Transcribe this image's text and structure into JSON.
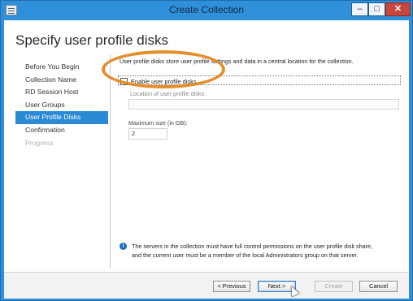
{
  "window": {
    "title": "Create Collection",
    "controls": {
      "minimize": "‒",
      "maximize": "□",
      "close": "✕"
    }
  },
  "page": {
    "title": "Specify user profile disks"
  },
  "nav": {
    "items": [
      {
        "label": "Before You Begin",
        "state": "normal"
      },
      {
        "label": "Collection Name",
        "state": "normal"
      },
      {
        "label": "RD Session Host",
        "state": "normal"
      },
      {
        "label": "User Groups",
        "state": "normal"
      },
      {
        "label": "User Profile Disks",
        "state": "selected"
      },
      {
        "label": "Confirmation",
        "state": "normal"
      },
      {
        "label": "Progress",
        "state": "disabled"
      }
    ]
  },
  "content": {
    "description": "User profile disks store user profile settings and data in a central location for the collection.",
    "enable_checkbox": {
      "label": "Enable user profile disks",
      "checked": false
    },
    "location": {
      "label": "Location of user profile disks:",
      "value": ""
    },
    "max_size": {
      "label": "Maximum size (in GB):",
      "value": "2"
    }
  },
  "info": {
    "icon": "info-icon",
    "line1": "The servers in the collection must have full control permissions on the user profile disk share,",
    "line2": "and the current user must be a member of the local Administrators group on that server."
  },
  "footer": {
    "previous_label": "< Previous",
    "next_label": "Next >",
    "create_label": "Create",
    "cancel_label": "Cancel"
  },
  "colors": {
    "accent": "#2a8ad4",
    "titlebar": "#2f8fd8",
    "highlight_oval": "#e2841a",
    "close_button": "#c7463d"
  }
}
